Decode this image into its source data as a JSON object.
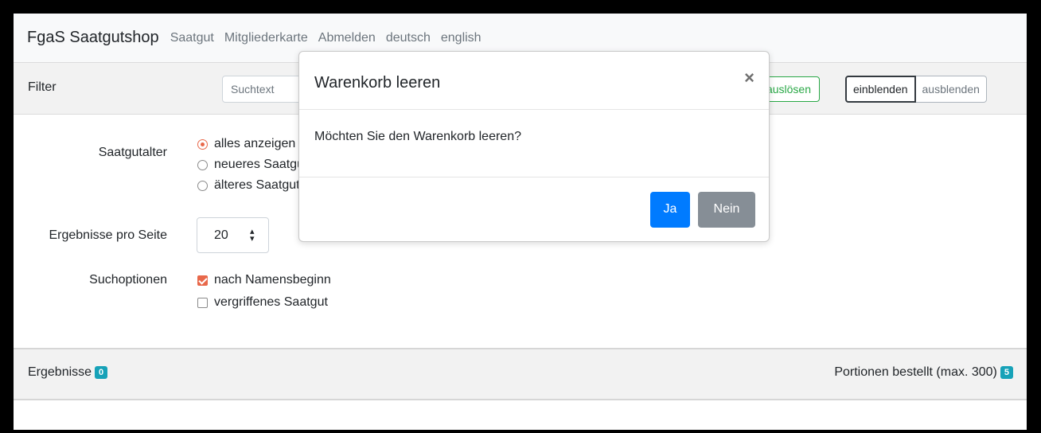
{
  "navbar": {
    "brand": "FgaS Saatgutshop",
    "links": [
      "Saatgut",
      "Mitgliederkarte",
      "Abmelden",
      "deutsch",
      "english"
    ]
  },
  "filter": {
    "title": "Filter",
    "search_placeholder": "Suchtext",
    "trigger_label": "auslösen",
    "show_label": "einblenden",
    "hide_label": "ausblenden"
  },
  "seed_age": {
    "label": "Saatgutalter",
    "options": [
      {
        "label": "alles anzeigen",
        "checked": true
      },
      {
        "label": "neueres Saatgut",
        "checked": false
      },
      {
        "label": "älteres Saatgut",
        "checked": false
      }
    ]
  },
  "per_page": {
    "label": "Ergebnisse pro Seite",
    "value": "20"
  },
  "search_options": {
    "label": "Suchoptionen",
    "options": [
      {
        "label": "nach Namensbeginn",
        "checked": true
      },
      {
        "label": "vergriffenes Saatgut",
        "checked": false
      }
    ]
  },
  "results": {
    "label": "Ergebnisse",
    "count": "0",
    "portions_label": "Portionen bestellt (max. 300)",
    "portions_count": "5"
  },
  "modal": {
    "title": "Warenkorb leeren",
    "close": "×",
    "body": "Möchten Sie den Warenkorb leeren?",
    "yes_label": "Ja",
    "no_label": "Nein"
  },
  "colors": {
    "primary": "#007bff",
    "secondary": "#868e96",
    "info_badge": "#17a2b8",
    "success": "#28a745",
    "accent": "#e8684a"
  }
}
